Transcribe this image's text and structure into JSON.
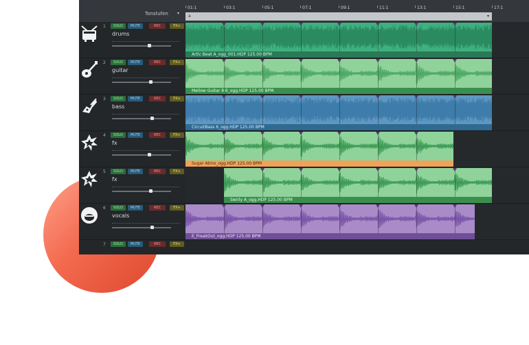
{
  "header": {
    "label": "Tonstufen",
    "caret": "▾"
  },
  "ruler": {
    "marks": [
      "01:1",
      "03:1",
      "05:1",
      "07:1",
      "09:1",
      "11:1",
      "13:1",
      "15:1",
      "17:1"
    ]
  },
  "range": {
    "start": "a",
    "end_caret": "▾"
  },
  "buttons": {
    "solo": "SOLO",
    "mute": "MUTE",
    "rec": "REC",
    "fx": "FX+"
  },
  "tracks": [
    {
      "num": "1",
      "name": "drums",
      "icon": "drum-icon",
      "clip": "Artic Beat A_ogg_001.HDP  125.00 BPM",
      "color": "#3fb07f"
    },
    {
      "num": "2",
      "name": "guitar",
      "icon": "guitar-icon",
      "clip": "Mellow Guitar 8 6_ogg.HDP  125.00 BPM",
      "color": "#8fd39a"
    },
    {
      "num": "3",
      "name": "bass",
      "icon": "bass-icon",
      "clip": "CircuitBass 6_ogg.HDP  125.00 BPM",
      "color": "#5f97c0"
    },
    {
      "num": "4",
      "name": "fx",
      "icon": "fx-icon",
      "clip": "Sugar Atmo_ogg.HDP  125.00 BPM",
      "color": "#8fd39a"
    },
    {
      "num": "5",
      "name": "fx",
      "icon": "fx-icon",
      "clip": "Swirly A_ogg.HDP  125.00 BPM",
      "color": "#8fd39a"
    },
    {
      "num": "6",
      "name": "vocals",
      "icon": "vocals-icon",
      "clip": "E_FreakOut_ogg.HDP  125.00 BPM",
      "color": "#a98bc8"
    },
    {
      "num": "7",
      "name": "",
      "icon": "",
      "clip": "",
      "color": ""
    }
  ]
}
